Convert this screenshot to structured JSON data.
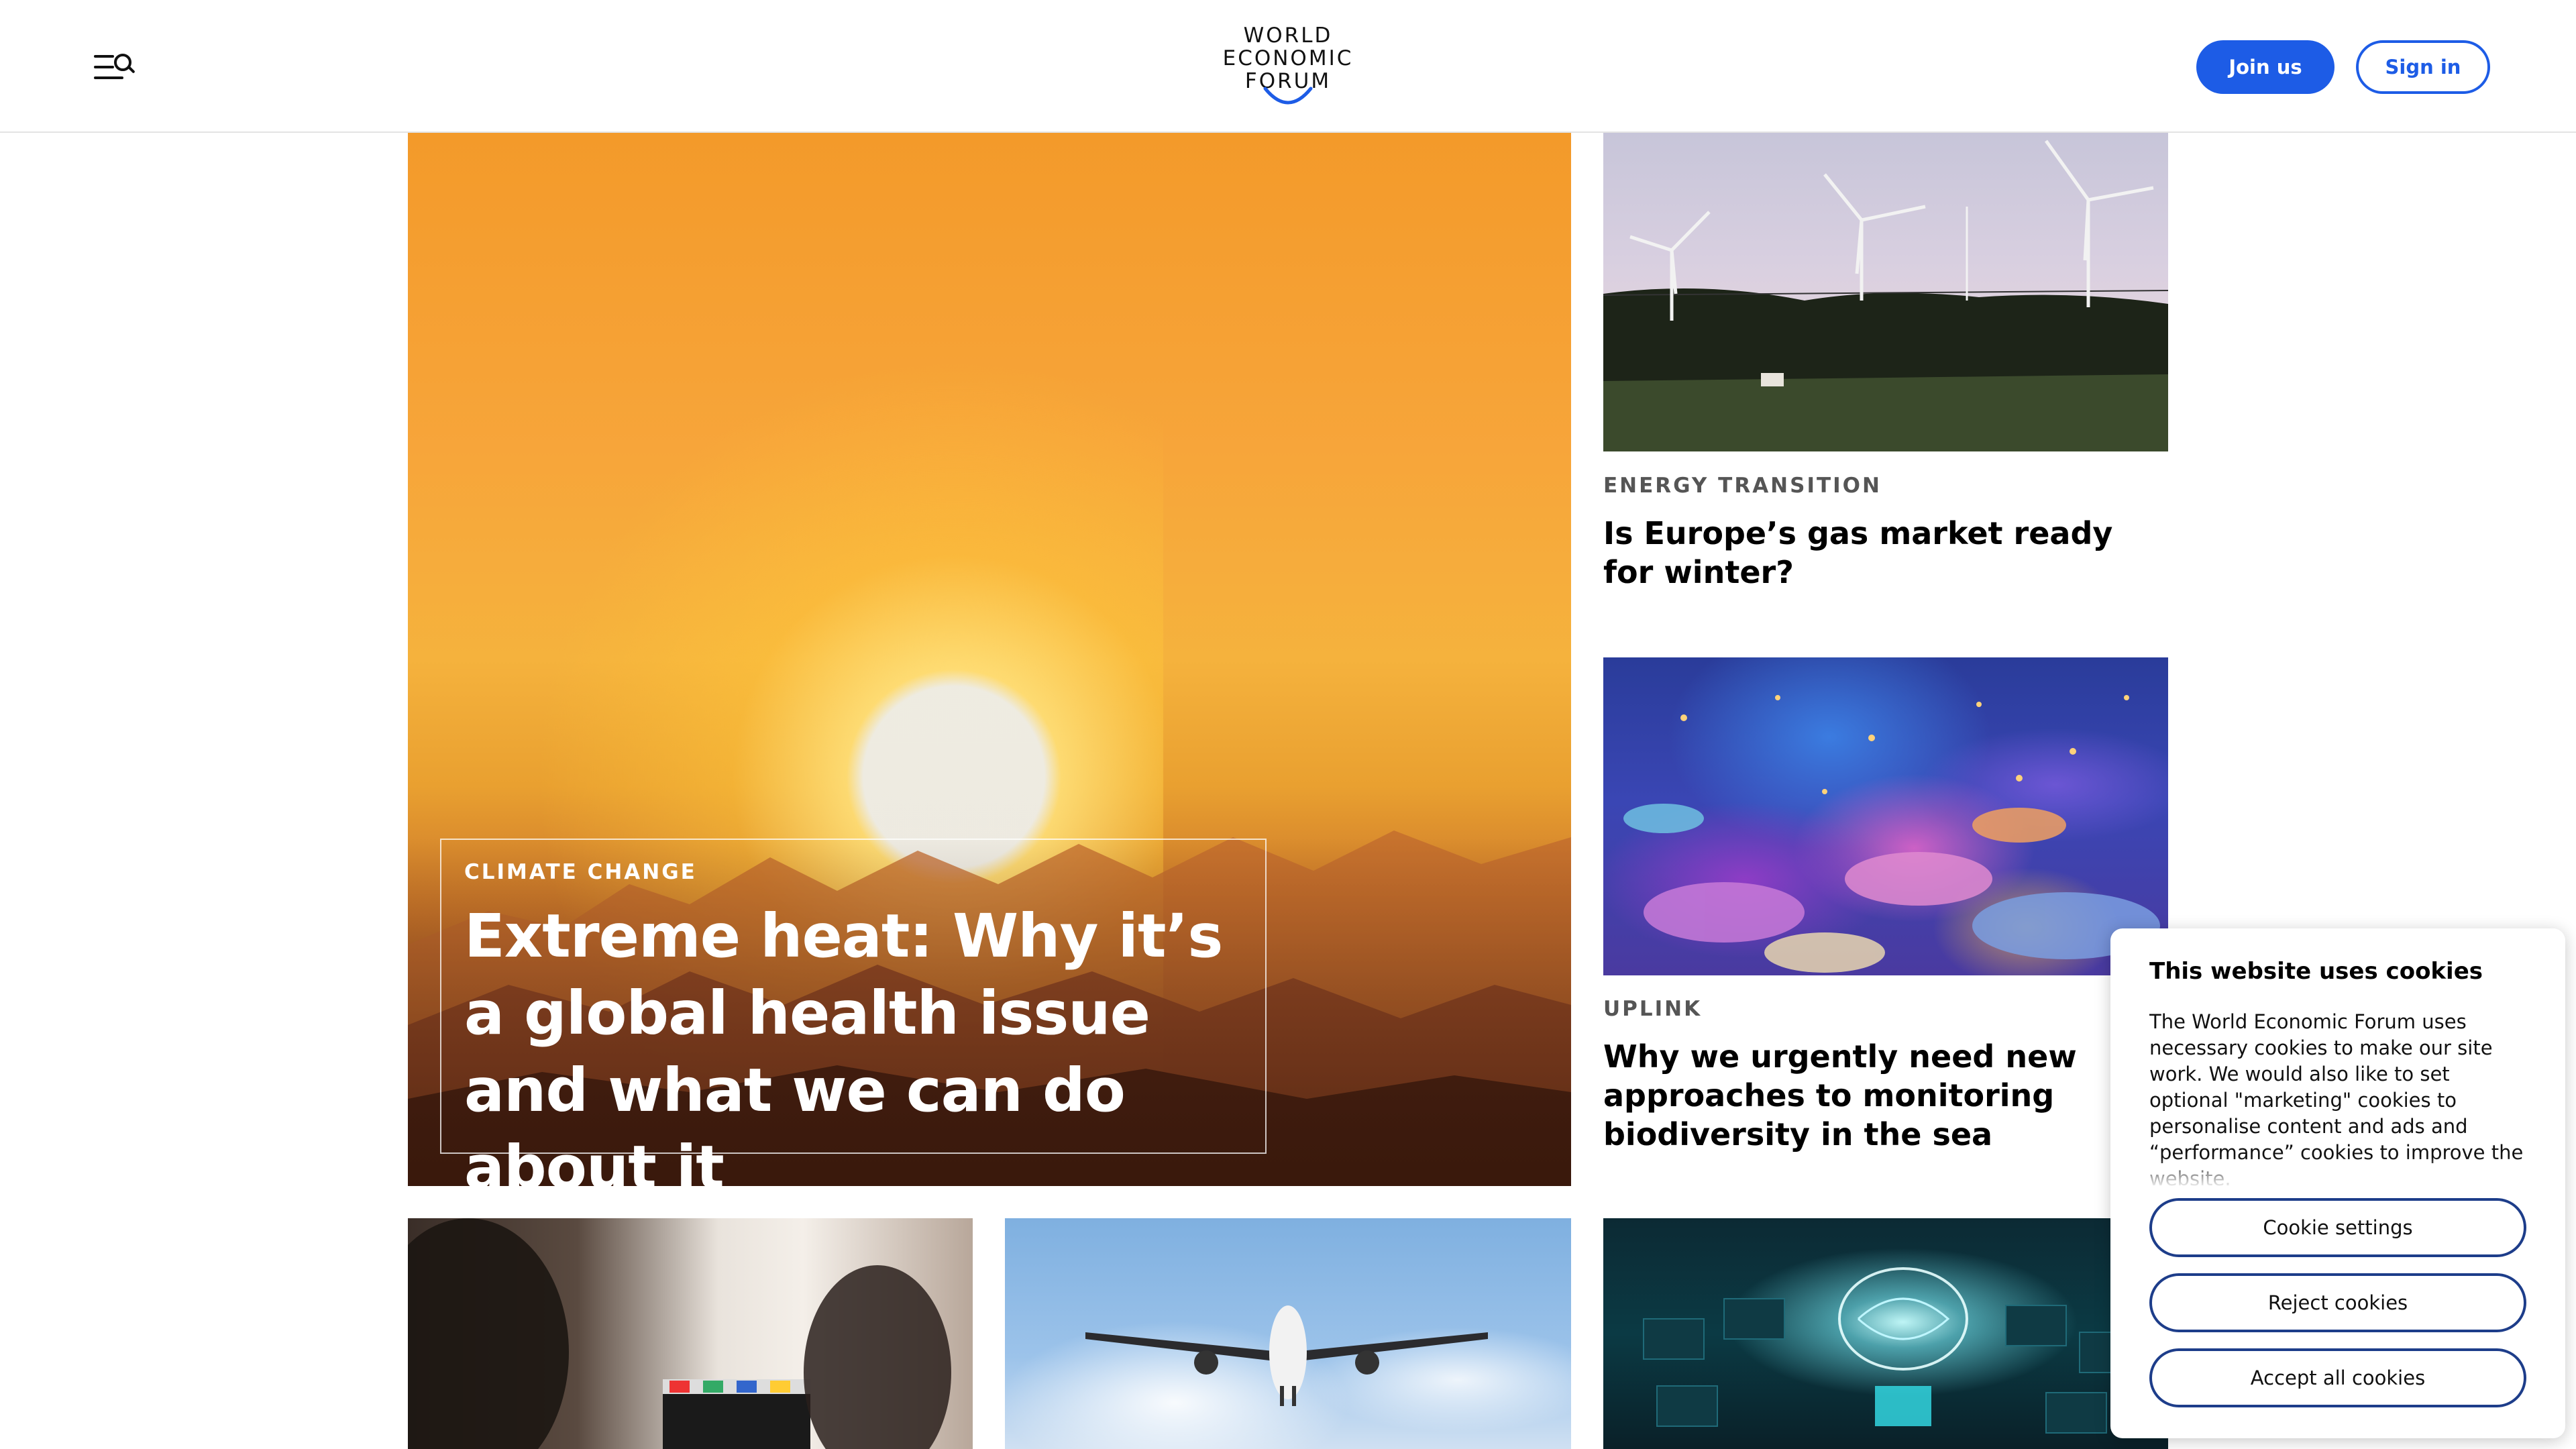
{
  "header": {
    "logo_lines": [
      "WORLD",
      "ECONOMIC",
      "FORUM"
    ],
    "menu_icon": "menu-search-icon",
    "join_label": "Join us",
    "signin_label": "Sign in",
    "accent_color": "#1d5ce6"
  },
  "hero": {
    "tag": "CLIMATE CHANGE",
    "title": "Extreme heat: Why it’s a global health issue and what we can do about it"
  },
  "articles": [
    {
      "tag": "ENERGY TRANSITION",
      "title": "Is Europe’s gas market ready for winter?"
    },
    {
      "tag": "UPLINK",
      "title": "Why we urgently need new approaches to monitoring biodiversity in the sea"
    }
  ],
  "cookie_banner": {
    "title": "This website uses cookies",
    "body": "The World Economic Forum uses necessary cookies to make our site work. We would also like to set optional \"marketing\" cookies to personalise content and ads and “performance” cookies to improve the website.",
    "settings_label": "Cookie settings",
    "reject_label": "Reject cookies",
    "accept_label": "Accept all cookies",
    "button_border_color": "#1d3d8a"
  }
}
